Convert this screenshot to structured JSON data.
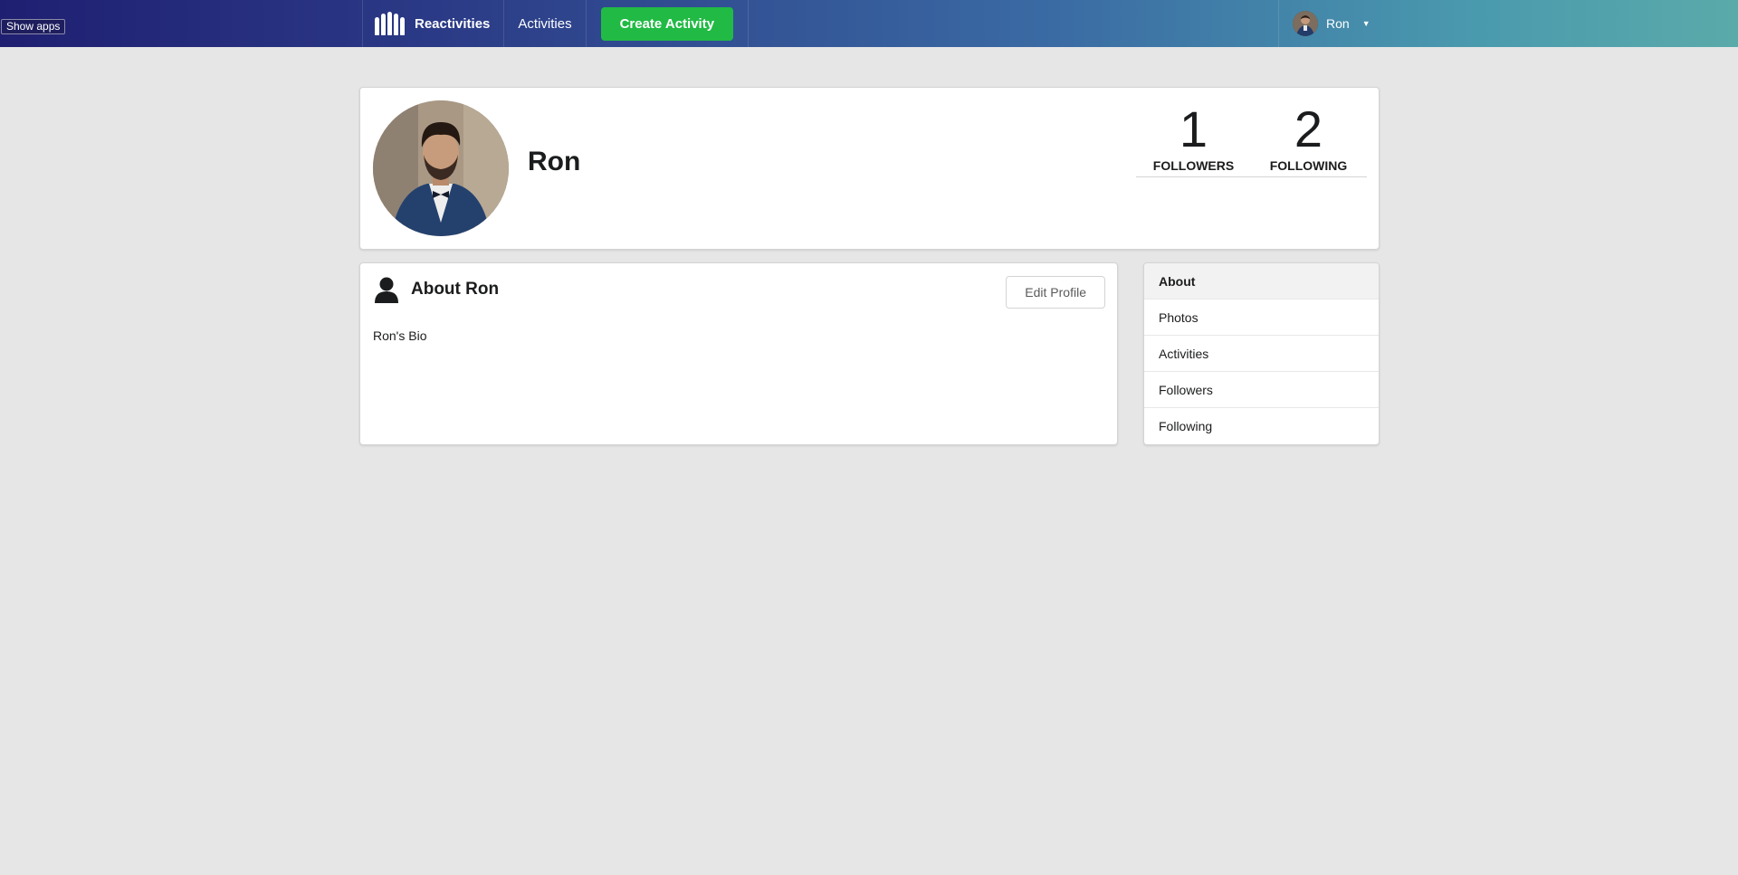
{
  "overlay": {
    "show_apps_label": "Show apps"
  },
  "nav": {
    "brand": "Reactivities",
    "activities": "Activities",
    "create_activity": "Create Activity",
    "user_name": "Ron"
  },
  "profile": {
    "display_name": "Ron",
    "followers_count": "1",
    "followers_label": "FOLLOWERS",
    "following_count": "2",
    "following_label": "FOLLOWING"
  },
  "about": {
    "title": "About Ron",
    "edit_button": "Edit Profile",
    "bio": "Ron's Bio"
  },
  "side_menu": {
    "items": [
      {
        "label": "About",
        "active": true
      },
      {
        "label": "Photos",
        "active": false
      },
      {
        "label": "Activities",
        "active": false
      },
      {
        "label": "Followers",
        "active": false
      },
      {
        "label": "Following",
        "active": false
      }
    ]
  },
  "colors": {
    "create_button": "#21ba45",
    "page_background": "#e6e6e6"
  }
}
